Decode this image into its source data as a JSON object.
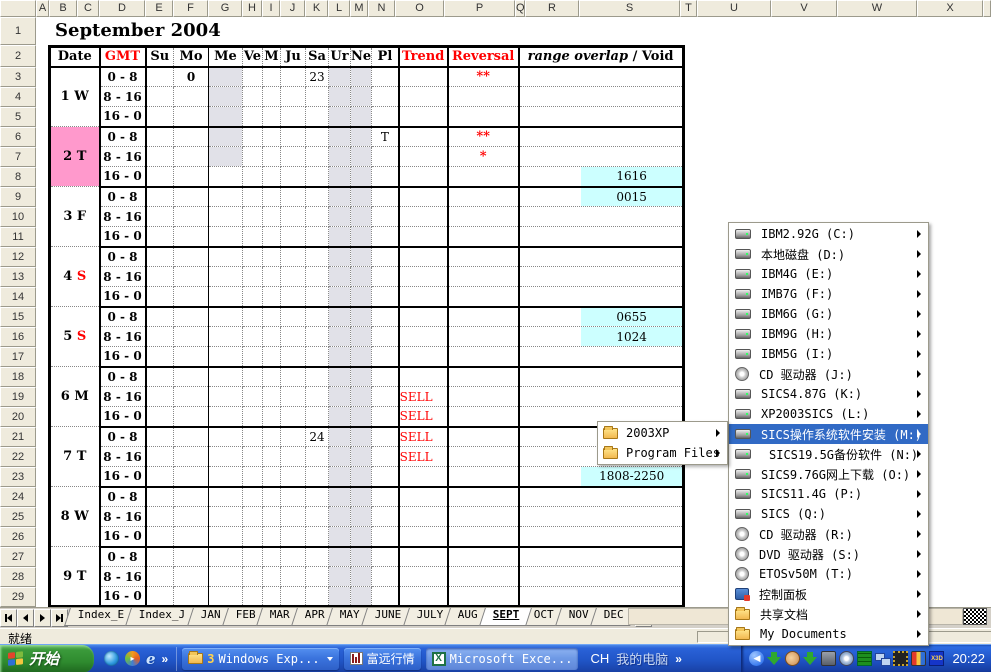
{
  "colors": {
    "highlight": "#316AC5",
    "pink": "#FF99CC",
    "cyan": "#CCFFFF",
    "red": "#FF0000",
    "gray_cell": "#E1E1E8"
  },
  "sheet": {
    "title": "September 2004",
    "status_message": "就绪",
    "col_headers": [
      "A",
      "B",
      "C",
      "D",
      "E",
      "F",
      "G",
      "H",
      "I",
      "J",
      "K",
      "L",
      "M",
      "N",
      "O",
      "P",
      "Q",
      "R",
      "S",
      "T",
      "U",
      "V",
      "W",
      "X"
    ],
    "row_count": 29,
    "tabs": {
      "items": [
        "Index_E",
        "Index_J",
        "JAN",
        "FEB",
        "MAR",
        "APR",
        "MAY",
        "JUNE",
        "JULY",
        "AUG",
        "SEPT",
        "OCT",
        "NOV",
        "DEC"
      ],
      "active": "SEPT"
    },
    "table": {
      "date_header": "Date",
      "gmt_header": "GMT",
      "planet_headers": [
        "Su",
        "Mo",
        "Me",
        "Ve",
        "M",
        "Ju",
        "Sa",
        "Ur",
        "Ne",
        "Pl"
      ],
      "trend_header": "Trend",
      "reversal_header": "Reversal",
      "range_header_italic": "range overlap",
      "range_header_rest": " / Void",
      "gmt_slots": [
        "0 - 8",
        "8 - 16",
        "16 - 0"
      ],
      "gray_columns": [
        "Ur",
        "Ne"
      ],
      "me_gray_rows": 5,
      "days": [
        {
          "num": "1",
          "dow": "W",
          "slots": [
            {
              "cells": {
                "Mo": "0",
                "Sa": "23"
              },
              "bold": [
                "Mo"
              ],
              "reversal": "**"
            },
            {},
            {}
          ]
        },
        {
          "num": "2",
          "dow": "T",
          "pink": true,
          "slots": [
            {
              "cells": {
                "Pl": "T"
              },
              "reversal": "**"
            },
            {
              "reversal": "*"
            },
            {
              "range": "1616"
            }
          ]
        },
        {
          "num": "3",
          "dow": "F",
          "slots": [
            {
              "range": "0015"
            },
            {},
            {}
          ]
        },
        {
          "num": "4",
          "dow": "S",
          "dow_red": true,
          "slots": [
            {},
            {},
            {}
          ]
        },
        {
          "num": "5",
          "dow": "S",
          "dow_red": true,
          "slots": [
            {
              "range": "0655"
            },
            {
              "range": "1024"
            },
            {}
          ]
        },
        {
          "num": "6",
          "dow": "M",
          "slots": [
            {},
            {
              "trend": "SELL"
            },
            {
              "trend": "SELL"
            }
          ]
        },
        {
          "num": "7",
          "dow": "T",
          "slots": [
            {
              "cells": {
                "Sa": "24"
              },
              "trend": "SELL"
            },
            {
              "trend": "SELL"
            },
            {
              "range": "1808-2250"
            }
          ]
        },
        {
          "num": "8",
          "dow": "W",
          "slots": [
            {},
            {},
            {}
          ]
        },
        {
          "num": "9",
          "dow": "T",
          "slots": [
            {},
            {},
            {}
          ]
        }
      ]
    }
  },
  "context_menu": {
    "items": [
      {
        "label": "IBM2.92G (C:)",
        "icon": "drive"
      },
      {
        "label": "本地磁盘 (D:)",
        "icon": "drive"
      },
      {
        "label": "IBM4G (E:)",
        "icon": "drive"
      },
      {
        "label": "IMB7G (F:)",
        "icon": "drive"
      },
      {
        "label": "IBM6G (G:)",
        "icon": "drive"
      },
      {
        "label": "IBM9G (H:)",
        "icon": "drive"
      },
      {
        "label": "IBM5G (I:)",
        "icon": "drive"
      },
      {
        "label": "CD 驱动器 (J:)",
        "icon": "cd"
      },
      {
        "label": "SICS4.87G (K:)",
        "icon": "drive"
      },
      {
        "label": "XP2003SICS (L:)",
        "icon": "drive"
      },
      {
        "label": "SICS操作系统软件安装 (M:)",
        "icon": "drive",
        "selected": true
      },
      {
        "label": "SICS19.5G备份软件 (N:)",
        "icon": "drive",
        "indent": true
      },
      {
        "label": "SICS9.76G网上下载 (O:)",
        "icon": "drive"
      },
      {
        "label": "SICS11.4G (P:)",
        "icon": "drive"
      },
      {
        "label": "SICS (Q:)",
        "icon": "drive"
      },
      {
        "label": "CD 驱动器 (R:)",
        "icon": "cd"
      },
      {
        "label": "DVD 驱动器 (S:)",
        "icon": "cd"
      },
      {
        "label": "ETOSv50M (T:)",
        "icon": "cd"
      },
      {
        "label": "控制面板",
        "icon": "cpanel"
      },
      {
        "label": "共享文档",
        "icon": "folder"
      },
      {
        "label": "My Documents",
        "icon": "folder"
      }
    ]
  },
  "submenu": {
    "items": [
      {
        "label": "2003XP",
        "icon": "folder"
      },
      {
        "label": "Program Files",
        "icon": "folder"
      }
    ]
  },
  "taskbar": {
    "start_label": "开始",
    "quick_launch_overflow": "»",
    "tasks": [
      {
        "icon": "folder",
        "count": "3",
        "label": "Windows Exp...",
        "dropdown": true
      },
      {
        "icon": "chart",
        "label": "富远行情"
      },
      {
        "icon": "excel",
        "label": "Microsoft Exce...",
        "active": true
      }
    ],
    "language_indicator": "CH",
    "desktop_toolbar_label": "我的电脑",
    "toolbar_overflow": "»",
    "clock": "20:22"
  }
}
